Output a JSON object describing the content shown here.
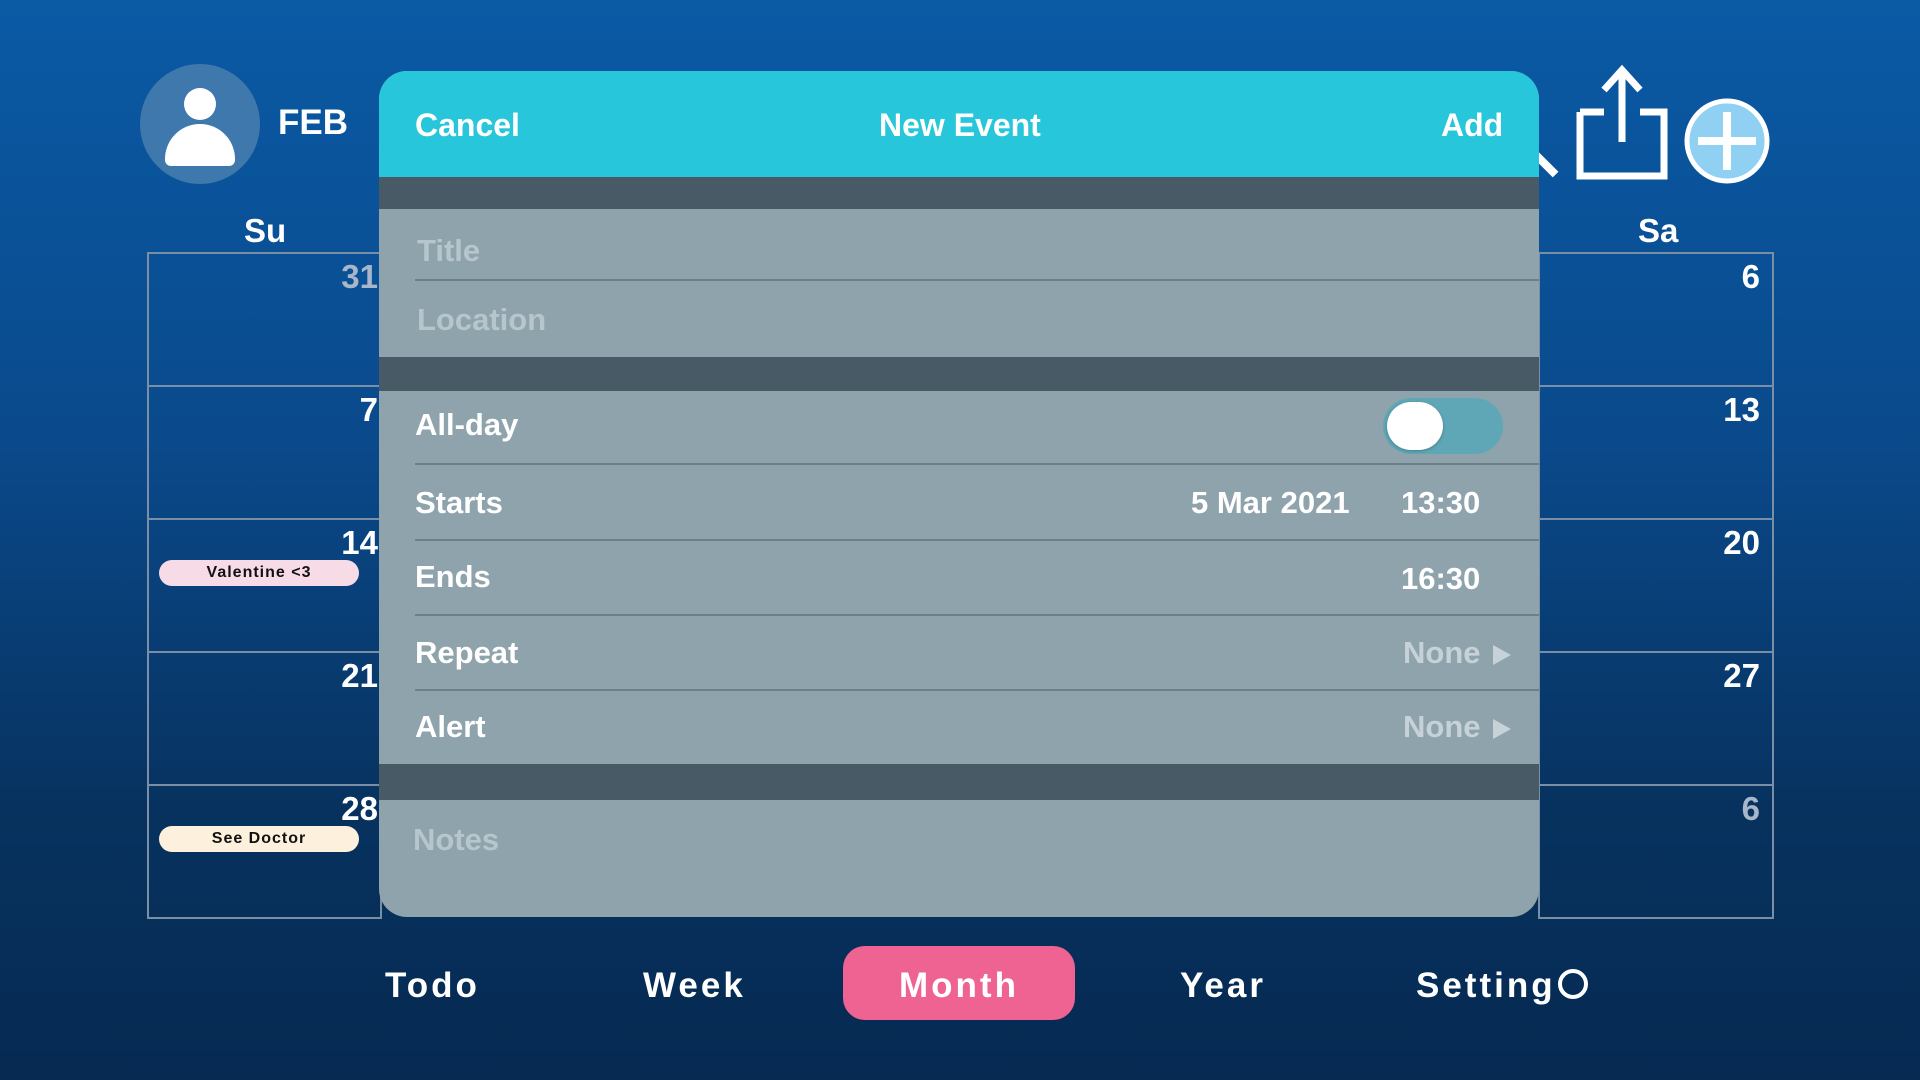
{
  "header": {
    "month": "FEB",
    "avatar_icon": "user-icon",
    "search_icon": "search-icon",
    "share_icon": "share-icon",
    "add_icon": "add-circle-icon"
  },
  "calendar": {
    "day_headers": {
      "sunday": "Su",
      "saturday": "Sa"
    },
    "sunday_cells": [
      {
        "day": "31",
        "dim": true
      },
      {
        "day": "7"
      },
      {
        "day": "14",
        "event": "Valentine <3",
        "event_color": "#f7dbe6"
      },
      {
        "day": "21"
      },
      {
        "day": "28",
        "event": "See Doctor",
        "event_color": "#fdf0dc"
      }
    ],
    "saturday_cells": [
      {
        "day": "6"
      },
      {
        "day": "13"
      },
      {
        "day": "20"
      },
      {
        "day": "27"
      },
      {
        "day": "6",
        "dim": true
      }
    ]
  },
  "modal": {
    "cancel": "Cancel",
    "title": "New Event",
    "add": "Add",
    "title_placeholder": "Title",
    "location_placeholder": "Location",
    "allday_label": "All-day",
    "allday_on": false,
    "starts_label": "Starts",
    "starts_date": "5 Mar 2021",
    "starts_time": "13:30",
    "ends_label": "Ends",
    "ends_time": "16:30",
    "repeat_label": "Repeat",
    "repeat_value": "None",
    "alert_label": "Alert",
    "alert_value": "None",
    "notes_placeholder": "Notes"
  },
  "nav": {
    "todo": "Todo",
    "week": "Week",
    "month": "Month",
    "year": "Year",
    "setting": "Setting",
    "active": "Month",
    "active_color": "#ef6393"
  }
}
